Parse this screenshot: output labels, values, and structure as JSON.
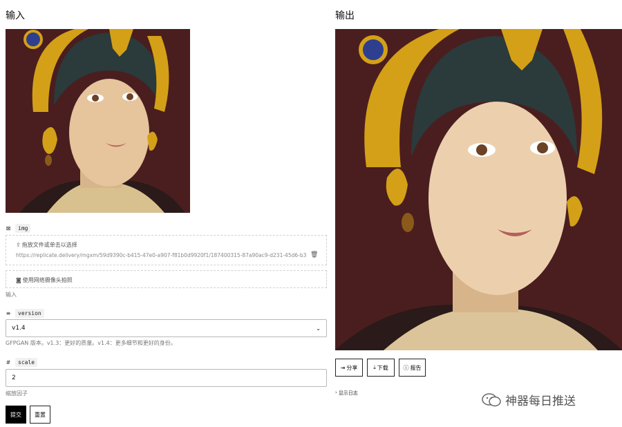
{
  "input": {
    "title": "输入",
    "img_label": "img",
    "img_icon": "image-icon",
    "dropzone_text": "拖放文件或单击以选择",
    "file_url": "https://replicate.delivery/mgxm/59d9390c-b415-47e0-a907-f81b0d9920f1/187400315-87a90ac9-d231-45d6-b377-38702...",
    "webcam_text": "使用网络摄像头拍照",
    "img_hint": "输入",
    "version_label": "version",
    "version_value": "v1.4",
    "version_hint": "GFPGAN 版本。v1.3：更好的质量。v1.4：更多细节和更好的身份。",
    "scale_label": "scale",
    "scale_value": "2",
    "scale_hint": "缩放因子",
    "submit_label": "提交",
    "reset_label": "重置"
  },
  "output": {
    "title": "输出",
    "share_label": "分享",
    "download_label": "下载",
    "report_label": "报告",
    "logs_label": "显示日志"
  },
  "watermark": {
    "text": "神器每日推送"
  },
  "colors": {
    "portrait_bg": "#4a1e1f",
    "gold": "#d4a017",
    "skin": "#e9c9a2"
  }
}
